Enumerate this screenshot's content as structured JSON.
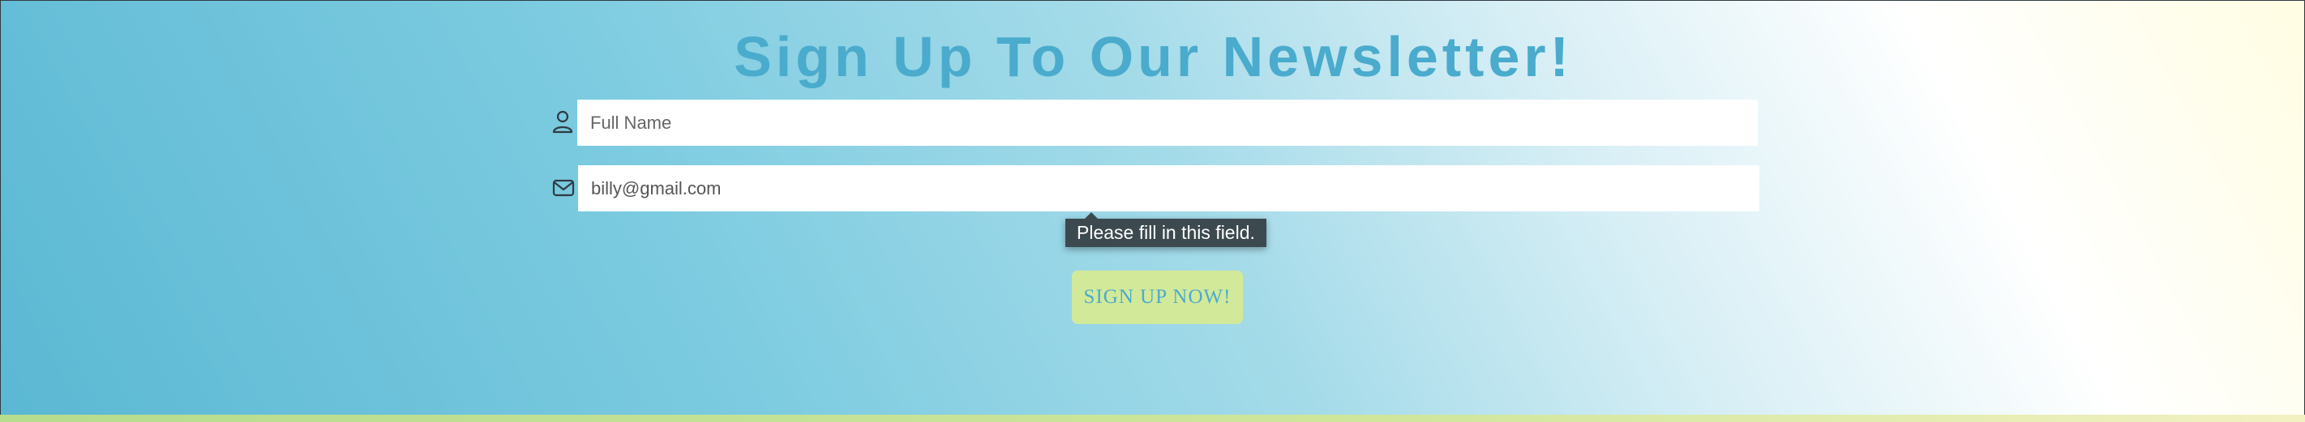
{
  "newsletter": {
    "title": "Sign Up To Our Newsletter!",
    "name_field": {
      "placeholder": "Full Name",
      "value": ""
    },
    "email_field": {
      "placeholder": "",
      "value": "billy@gmail.com"
    },
    "validation_tooltip": "Please fill in this field.",
    "submit_label": "SIGN UP NOW!"
  },
  "icons": {
    "name": "user-icon",
    "email": "envelope-icon"
  },
  "colors": {
    "title": "#4aabcd",
    "button_bg": "#d3e99a",
    "button_text": "#4aabcd",
    "tooltip_bg": "#3c4a50"
  }
}
